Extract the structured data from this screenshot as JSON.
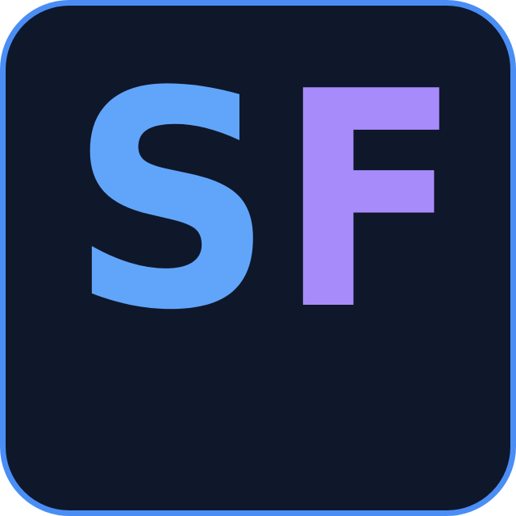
{
  "logo": {
    "letter_first": "S",
    "letter_second": "F",
    "colors": {
      "background": "#0f172a",
      "border": "#4a8ef5",
      "letter_first": "#60a5fa",
      "letter_second": "#a78bfa"
    }
  }
}
